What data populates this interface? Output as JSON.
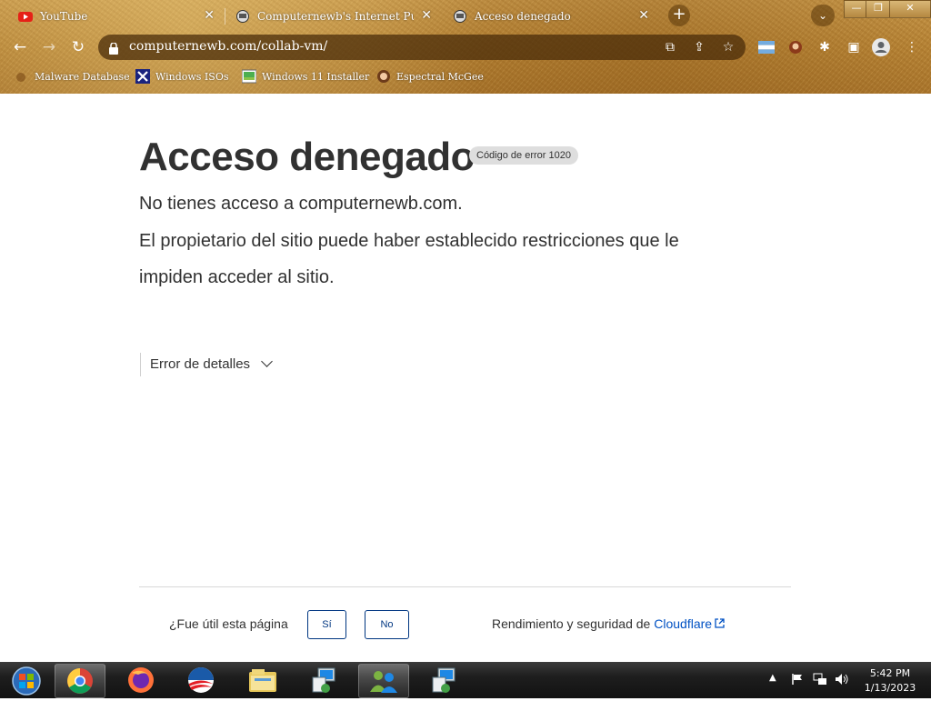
{
  "browser": {
    "tabs": [
      {
        "title": "YouTube",
        "favicon": "youtube-icon"
      },
      {
        "title": "Computernewb's Internet Pub Hu",
        "favicon": "globe-icon"
      },
      {
        "title": "Acceso denegado",
        "favicon": "globe-icon",
        "active": true
      }
    ],
    "url": "computernewb.com/collab-vm/",
    "new_tab_label": "+",
    "window_buttons": {
      "minimize": "—",
      "maximize": "❐",
      "close": "✕"
    }
  },
  "bookmarks": [
    {
      "label": "Malware Database",
      "icon": "malware-icon"
    },
    {
      "label": "Windows ISOs",
      "icon": "x-icon"
    },
    {
      "label": "Windows 11 Installer",
      "icon": "image-icon"
    },
    {
      "label": "Espectral McGee",
      "icon": "avatar-icon"
    }
  ],
  "page": {
    "title": "Acceso denegado",
    "error_code": "Código de error 1020",
    "line1": "No tienes acceso a computernewb.com.",
    "line2": "El propietario del sitio puede haber establecido restricciones que le",
    "line3": "impiden acceder al sitio.",
    "details_label": "Error de detalles",
    "feedback_question": "¿Fue útil esta página",
    "yes_label": "Sí",
    "no_label": "No",
    "perf_text": "Rendimiento y seguridad de ",
    "cloudflare_label": "Cloudflare"
  },
  "taskbar": {
    "time": "5:42 PM",
    "date": "1/13/2023",
    "apps": [
      "start-icon",
      "chrome-icon",
      "firefox-icon",
      "obama-icon",
      "explorer-icon",
      "network-setup-icon",
      "messenger-icon",
      "network-setup-icon"
    ]
  },
  "colors": {
    "accent": "#003681",
    "link": "#0051c3",
    "text": "#313131"
  }
}
